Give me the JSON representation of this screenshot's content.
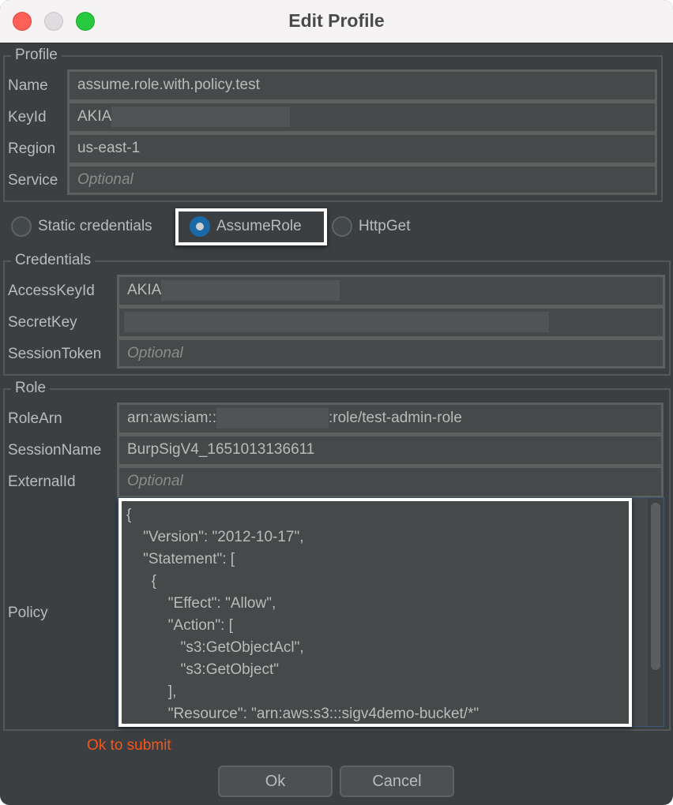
{
  "window": {
    "title": "Edit Profile",
    "controls": [
      "close",
      "minimize",
      "maximize"
    ]
  },
  "profile": {
    "legend": "Profile",
    "fields": [
      {
        "label": "Name",
        "value": "assume.role.with.policy.test",
        "placeholder": ""
      },
      {
        "label": "KeyId",
        "value": "AKIA",
        "placeholder": "",
        "redacted": true
      },
      {
        "label": "Region",
        "value": "us-east-1",
        "placeholder": ""
      },
      {
        "label": "Service",
        "value": "",
        "placeholder": "Optional"
      }
    ]
  },
  "auth_type": {
    "options": [
      {
        "label": "Static credentials",
        "selected": false
      },
      {
        "label": "AssumeRole",
        "selected": true
      },
      {
        "label": "HttpGet",
        "selected": false
      }
    ]
  },
  "credentials": {
    "legend": "Credentials",
    "fields": [
      {
        "label": "AccessKeyId",
        "value": "AKIA",
        "placeholder": "",
        "redacted": true
      },
      {
        "label": "SecretKey",
        "value": "",
        "placeholder": "",
        "redacted": true
      },
      {
        "label": "SessionToken",
        "value": "",
        "placeholder": "Optional"
      }
    ]
  },
  "role": {
    "legend": "Role",
    "fields": [
      {
        "label": "RoleArn",
        "value_prefix": "arn:aws:iam::",
        "value_suffix": ":role/test-admin-role",
        "redacted": true
      },
      {
        "label": "SessionName",
        "value": "BurpSigV4_1651013136611"
      },
      {
        "label": "ExternalId",
        "value": "",
        "placeholder": "Optional"
      }
    ],
    "policy_label": "Policy",
    "policy_text": "{\n    \"Version\": \"2012-10-17\",\n    \"Statement\": [\n      {\n          \"Effect\": \"Allow\",\n          \"Action\": [\n             \"s3:GetObjectAcl\",\n             \"s3:GetObject\"\n          ],\n          \"Resource\": \"arn:aws:s3:::sigv4demo-bucket/*\""
  },
  "status": {
    "text": "Ok to submit",
    "color": "#f2561d"
  },
  "buttons": {
    "ok": "Ok",
    "cancel": "Cancel"
  }
}
